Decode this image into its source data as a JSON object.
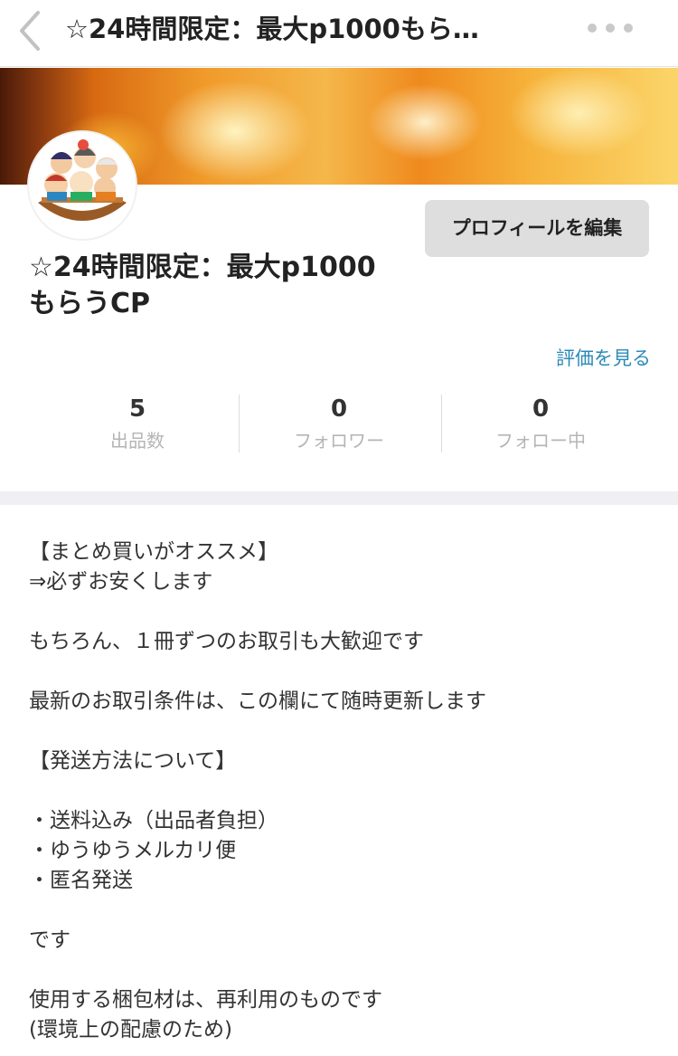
{
  "nav": {
    "title": "☆24時間限定：最大p1000もら…",
    "back_icon": "chevron-left-icon",
    "more_icon": "more-horizontal-icon"
  },
  "profile": {
    "name_line1": "☆24時間限定：最大p1000",
    "name_line2": "もらうCP",
    "edit_button": "プロフィールを編集",
    "ratings_link": "評価を見る",
    "avatar_icon": "seven-lucky-gods-avatar"
  },
  "stats": [
    {
      "value": "5",
      "label": "出品数"
    },
    {
      "value": "0",
      "label": "フォロワー"
    },
    {
      "value": "0",
      "label": "フォロー中"
    }
  ],
  "description": [
    "【まとめ買いがオススメ】",
    "⇒必ずお安くします",
    "",
    "もちろん、１冊ずつのお取引も大歓迎です",
    "",
    "最新のお取引条件は、この欄にて随時更新します",
    "",
    "【発送方法について】",
    "",
    "・送料込み（出品者負担）",
    "・ゆうゆうメルカリ便",
    "・匿名発送",
    "",
    "です",
    "",
    "使用する梱包材は、再利用のものです",
    "(環境上の配慮のため)"
  ],
  "colors": {
    "link": "#2b8ab8",
    "button_bg": "#dedede",
    "section_gap": "#efeff4"
  }
}
